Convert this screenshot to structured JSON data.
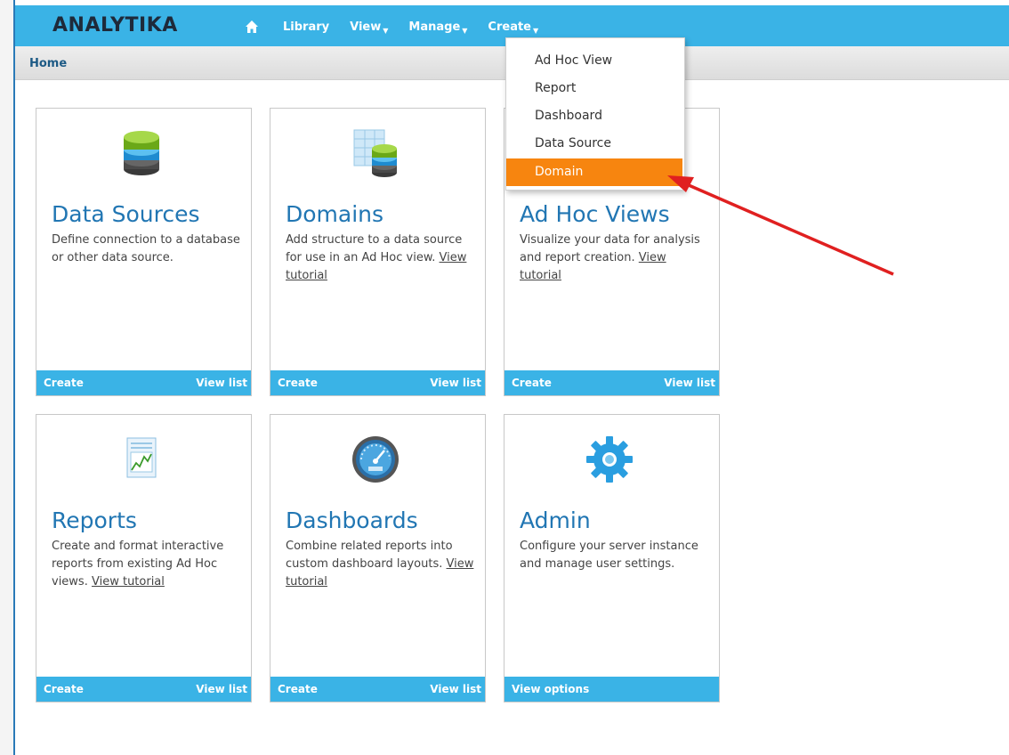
{
  "app": {
    "logo": "ANALYTIKA"
  },
  "nav": {
    "items": [
      {
        "label": "Library",
        "caret": false
      },
      {
        "label": "View",
        "caret": true
      },
      {
        "label": "Manage",
        "caret": true
      },
      {
        "label": "Create",
        "caret": true
      }
    ]
  },
  "breadcrumb": {
    "label": "Home"
  },
  "dropdown": {
    "items": [
      "Ad Hoc View",
      "Report",
      "Dashboard",
      "Data Source",
      "Domain"
    ],
    "active": "Domain",
    "active_color": "#f7850f"
  },
  "cards": [
    {
      "icon": "database-icon",
      "title": "Data Sources",
      "desc": "Define connection to a database or other data source.",
      "link": "",
      "left_action": "Create",
      "right_action": "View list"
    },
    {
      "icon": "domain-icon",
      "title": "Domains",
      "desc": "Add structure to a data source for use in an Ad Hoc view.",
      "link": "View tutorial",
      "left_action": "Create",
      "right_action": "View list"
    },
    {
      "icon": "adhoc-icon",
      "title": "Ad Hoc Views",
      "desc": "Visualize your data for analysis and report creation.",
      "link": "View tutorial",
      "left_action": "Create",
      "right_action": "View list"
    },
    {
      "icon": "report-icon",
      "title": "Reports",
      "desc": "Create and format interactive reports from existing Ad Hoc views.",
      "link": "View tutorial",
      "left_action": "Create",
      "right_action": "View list"
    },
    {
      "icon": "gauge-icon",
      "title": "Dashboards",
      "desc": "Combine related reports into custom dashboard layouts.",
      "link": "View tutorial",
      "left_action": "Create",
      "right_action": "View list"
    },
    {
      "icon": "gear-icon",
      "title": "Admin",
      "desc": "Configure your server instance and manage user settings.",
      "link": "",
      "left_action": "View options",
      "right_action": ""
    }
  ],
  "colors": {
    "accent": "#3ab3e6",
    "title": "#2176b3",
    "arrow": "#e02020"
  }
}
